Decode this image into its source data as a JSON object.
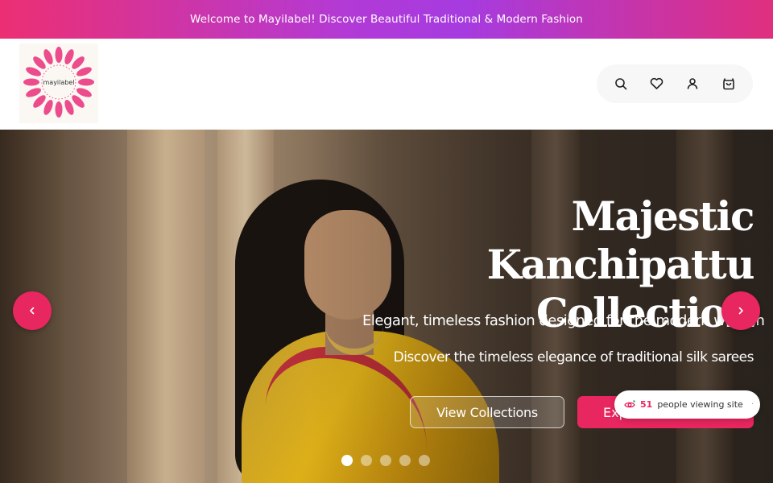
{
  "announcement": {
    "text": "Welcome to Mayilabel! Discover Beautiful Traditional & Modern Fashion"
  },
  "header": {
    "logo_text": "mayilabel",
    "icons": [
      "search-icon",
      "heart-icon",
      "user-icon",
      "cart-icon"
    ]
  },
  "hero": {
    "title_line1": "Majestic Kanchipattu",
    "title_line2": "Collection",
    "subtitle": "Elegant, timeless fashion designed for the modern woman",
    "description": "Discover the timeless elegance of traditional silk sarees",
    "view_button": "View Collections",
    "explore_button": "Explore Now",
    "slide_count": 5,
    "active_slide": 1
  },
  "viewing": {
    "count": "51",
    "label": "people viewing site"
  },
  "colors": {
    "accent": "#e8265f",
    "announce_left": "#ec2f73",
    "announce_mid": "#a63be0"
  }
}
